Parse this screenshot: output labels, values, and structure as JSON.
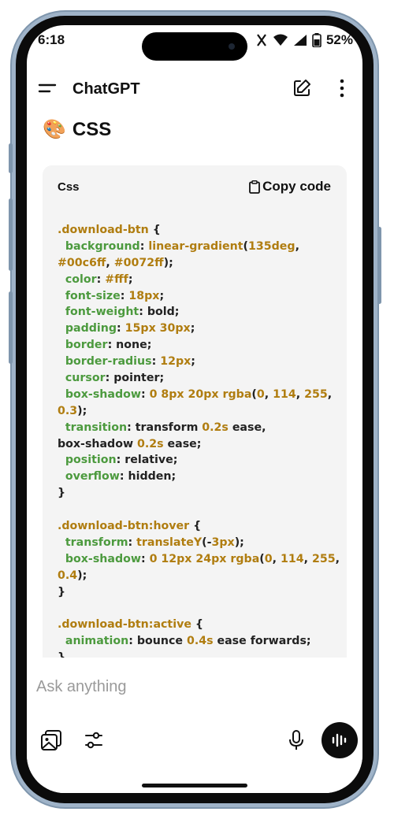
{
  "status_bar": {
    "time": "6:18",
    "battery": "52%",
    "icons": [
      "vibrate-icon",
      "wifi-icon",
      "signal-icon",
      "battery-icon"
    ]
  },
  "header": {
    "title": "ChatGPT",
    "icons": [
      "menu-icon",
      "edit-icon",
      "more-options-icon"
    ]
  },
  "section": {
    "emoji": "🎨",
    "title": "CSS"
  },
  "code_block": {
    "language": "Css",
    "copy_label": "Copy code",
    "lines": [
      [
        {
          "t": ".download-btn",
          "c": "sel"
        },
        {
          "t": " {",
          "c": "plain"
        }
      ],
      [
        {
          "t": "  background",
          "c": "prop"
        },
        {
          "t": ": ",
          "c": "plain"
        },
        {
          "t": "linear-gradient",
          "c": "fn"
        },
        {
          "t": "(",
          "c": "plain"
        },
        {
          "t": "135deg",
          "c": "num"
        },
        {
          "t": ",",
          "c": "plain"
        }
      ],
      [
        {
          "t": "#00c6ff",
          "c": "num"
        },
        {
          "t": ", ",
          "c": "plain"
        },
        {
          "t": "#0072ff",
          "c": "num"
        },
        {
          "t": ");",
          "c": "plain"
        }
      ],
      [
        {
          "t": "  color",
          "c": "prop"
        },
        {
          "t": ": ",
          "c": "plain"
        },
        {
          "t": "#fff",
          "c": "num"
        },
        {
          "t": ";",
          "c": "plain"
        }
      ],
      [
        {
          "t": "  font-size",
          "c": "prop"
        },
        {
          "t": ": ",
          "c": "plain"
        },
        {
          "t": "18px",
          "c": "num"
        },
        {
          "t": ";",
          "c": "plain"
        }
      ],
      [
        {
          "t": "  font-weight",
          "c": "prop"
        },
        {
          "t": ": bold;",
          "c": "plain"
        }
      ],
      [
        {
          "t": "  padding",
          "c": "prop"
        },
        {
          "t": ": ",
          "c": "plain"
        },
        {
          "t": "15px 30px",
          "c": "num"
        },
        {
          "t": ";",
          "c": "plain"
        }
      ],
      [
        {
          "t": "  border",
          "c": "prop"
        },
        {
          "t": ": none;",
          "c": "plain"
        }
      ],
      [
        {
          "t": "  border-radius",
          "c": "prop"
        },
        {
          "t": ": ",
          "c": "plain"
        },
        {
          "t": "12px",
          "c": "num"
        },
        {
          "t": ";",
          "c": "plain"
        }
      ],
      [
        {
          "t": "  cursor",
          "c": "prop"
        },
        {
          "t": ": pointer;",
          "c": "plain"
        }
      ],
      [
        {
          "t": "  box-shadow",
          "c": "prop"
        },
        {
          "t": ": ",
          "c": "plain"
        },
        {
          "t": "0 8px 20px",
          "c": "num"
        },
        {
          "t": " ",
          "c": "plain"
        },
        {
          "t": "rgba",
          "c": "fn"
        },
        {
          "t": "(",
          "c": "plain"
        },
        {
          "t": "0",
          "c": "num"
        },
        {
          "t": ", ",
          "c": "plain"
        },
        {
          "t": "114",
          "c": "num"
        },
        {
          "t": ", ",
          "c": "plain"
        },
        {
          "t": "255",
          "c": "num"
        },
        {
          "t": ",",
          "c": "plain"
        }
      ],
      [
        {
          "t": "0.3",
          "c": "num"
        },
        {
          "t": ");",
          "c": "plain"
        }
      ],
      [
        {
          "t": "  transition",
          "c": "prop"
        },
        {
          "t": ": transform ",
          "c": "plain"
        },
        {
          "t": "0.2s",
          "c": "num"
        },
        {
          "t": " ease,",
          "c": "plain"
        }
      ],
      [
        {
          "t": "box-shadow ",
          "c": "plain"
        },
        {
          "t": "0.2s",
          "c": "num"
        },
        {
          "t": " ease;",
          "c": "plain"
        }
      ],
      [
        {
          "t": "  position",
          "c": "prop"
        },
        {
          "t": ": relative;",
          "c": "plain"
        }
      ],
      [
        {
          "t": "  overflow",
          "c": "prop"
        },
        {
          "t": ": hidden;",
          "c": "plain"
        }
      ],
      [
        {
          "t": "}",
          "c": "plain"
        }
      ],
      [
        {
          "t": "",
          "c": "plain"
        }
      ],
      [
        {
          "t": ".download-btn:hover",
          "c": "sel"
        },
        {
          "t": " {",
          "c": "plain"
        }
      ],
      [
        {
          "t": "  transform",
          "c": "prop"
        },
        {
          "t": ": ",
          "c": "plain"
        },
        {
          "t": "translateY",
          "c": "fn"
        },
        {
          "t": "(-",
          "c": "plain"
        },
        {
          "t": "3px",
          "c": "num"
        },
        {
          "t": ");",
          "c": "plain"
        }
      ],
      [
        {
          "t": "  box-shadow",
          "c": "prop"
        },
        {
          "t": ": ",
          "c": "plain"
        },
        {
          "t": "0 12px 24px",
          "c": "num"
        },
        {
          "t": " ",
          "c": "plain"
        },
        {
          "t": "rgba",
          "c": "fn"
        },
        {
          "t": "(",
          "c": "plain"
        },
        {
          "t": "0",
          "c": "num"
        },
        {
          "t": ", ",
          "c": "plain"
        },
        {
          "t": "114",
          "c": "num"
        },
        {
          "t": ", ",
          "c": "plain"
        },
        {
          "t": "255",
          "c": "num"
        },
        {
          "t": ",",
          "c": "plain"
        }
      ],
      [
        {
          "t": "0.4",
          "c": "num"
        },
        {
          "t": ");",
          "c": "plain"
        }
      ],
      [
        {
          "t": "}",
          "c": "plain"
        }
      ],
      [
        {
          "t": "",
          "c": "plain"
        }
      ],
      [
        {
          "t": ".download-btn:active",
          "c": "sel"
        },
        {
          "t": " {",
          "c": "plain"
        }
      ],
      [
        {
          "t": "  animation",
          "c": "prop"
        },
        {
          "t": ": bounce ",
          "c": "plain"
        },
        {
          "t": "0.4s",
          "c": "num"
        },
        {
          "t": " ease forwards;",
          "c": "plain"
        }
      ],
      [
        {
          "t": "}",
          "c": "plain"
        }
      ]
    ]
  },
  "composer": {
    "placeholder": "Ask anything",
    "icons": [
      "image-icon",
      "tools-icon",
      "microphone-icon",
      "voice-mode-icon"
    ]
  },
  "colors": {
    "selector": "#b07d10",
    "property": "#4c9a3e",
    "code_bg": "#f4f4f4",
    "frame": "#9fb3c8"
  }
}
